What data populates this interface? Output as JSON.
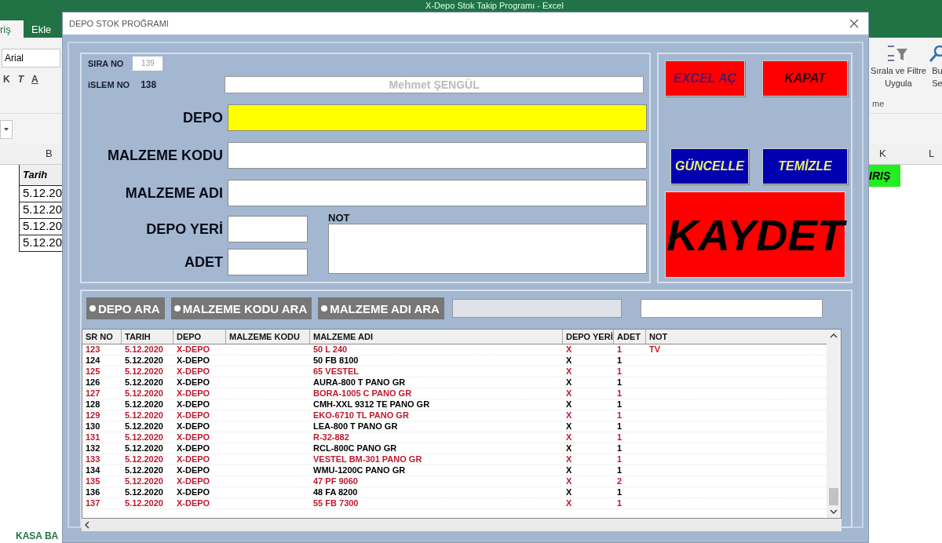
{
  "excel": {
    "title": "X-Depo Stok Takip Programı - Excel",
    "tabs": [
      {
        "label": "riş",
        "selected": true
      },
      {
        "label": "Ekle",
        "selected": false
      }
    ],
    "font_box": "Arial",
    "format_buttons": [
      "K",
      "T",
      "A"
    ],
    "sort_label": [
      "Sırala ve Filtre",
      "Uygula"
    ],
    "search_label": [
      "Bu",
      "Se"
    ],
    "group_label": "me",
    "col_b": "B",
    "col_k": "K",
    "col_l": "L",
    "header_cell": "Tarih",
    "dates": [
      "5.12.20",
      "5.12.20",
      "5.12.20",
      "5.12.20"
    ],
    "green_cell": "IRIŞ",
    "sheet_tab": "KASA BA"
  },
  "dialog": {
    "title": "DEPO STOK PROĞRAMI",
    "sira_no": {
      "label": "SIRA NO",
      "value": "139",
      "disabled": true
    },
    "islem_no": {
      "label": "iSLEM NO",
      "value": "138"
    },
    "user_field": {
      "value": "Mehmet  ŞENGÜL",
      "disabled": true
    },
    "fields": [
      {
        "label": "DEPO",
        "focused": true,
        "kind": "wide"
      },
      {
        "label": "MALZEME KODU",
        "focused": false,
        "kind": "wide"
      },
      {
        "label": "MALZEME ADI",
        "focused": false,
        "kind": "wide"
      },
      {
        "label": "DEPO YERİ",
        "focused": false,
        "kind": "short"
      },
      {
        "label": "ADET",
        "focused": false,
        "kind": "short"
      }
    ],
    "note": {
      "label": "NOT"
    },
    "buttons": [
      {
        "label": "EXCEL AÇ",
        "kind": "red"
      },
      {
        "label": "KAPAT",
        "kind": "red"
      },
      {
        "label": "GÜNCELLE",
        "kind": "blue"
      },
      {
        "label": "TEMİZLE",
        "kind": "blue"
      }
    ],
    "save_button": "KAYDET",
    "search_options": [
      {
        "label": "DEPO ARA",
        "selected": false
      },
      {
        "label": "MALZEME KODU ARA",
        "selected": false
      },
      {
        "label": "MALZEME ADI ARA",
        "selected": false
      }
    ],
    "search_field": {
      "disabled": true
    },
    "filter_field": {
      "disabled": false
    },
    "table": {
      "columns": [
        "SR NO",
        "TARIH",
        "DEPO",
        "MALZEME KODU",
        "MALZEME ADI",
        "DEPO YERİ",
        "ADET",
        "NOT"
      ],
      "rows": [
        {
          "color": "#c0182c",
          "cells": [
            "123",
            "5.12.2020",
            "X-DEPO",
            "",
            "50 L 240",
            "X",
            "1",
            "TV"
          ]
        },
        {
          "color": "#000000",
          "cells": [
            "124",
            "5.12.2020",
            "X-DEPO",
            "",
            "50 FB 8100",
            "X",
            "1",
            ""
          ]
        },
        {
          "color": "#c0182c",
          "cells": [
            "125",
            "5.12.2020",
            "X-DEPO",
            "",
            "65 VESTEL",
            "X",
            "1",
            ""
          ]
        },
        {
          "color": "#000000",
          "cells": [
            "126",
            "5.12.2020",
            "X-DEPO",
            "",
            "AURA-800 T PANO GR",
            "X",
            "1",
            ""
          ]
        },
        {
          "color": "#c0182c",
          "cells": [
            "127",
            "5.12.2020",
            "X-DEPO",
            "",
            "BORA-1005 C PANO GR",
            "X",
            "1",
            ""
          ]
        },
        {
          "color": "#000000",
          "cells": [
            "128",
            "5.12.2020",
            "X-DEPO",
            "",
            "CMH-XXL 9312 TE PANO GR",
            "X",
            "1",
            ""
          ]
        },
        {
          "color": "#c0182c",
          "cells": [
            "129",
            "5.12.2020",
            "X-DEPO",
            "",
            "EKO-6710 TL  PANO GR",
            "X",
            "1",
            ""
          ]
        },
        {
          "color": "#000000",
          "cells": [
            "130",
            "5.12.2020",
            "X-DEPO",
            "",
            "LEA-800 T PANO GR",
            "X",
            "1",
            ""
          ]
        },
        {
          "color": "#c0182c",
          "cells": [
            "131",
            "5.12.2020",
            "X-DEPO",
            "",
            "R-32-882",
            "X",
            "1",
            ""
          ]
        },
        {
          "color": "#000000",
          "cells": [
            "132",
            "5.12.2020",
            "X-DEPO",
            "",
            "RCL-800C PANO GR",
            "X",
            "1",
            ""
          ]
        },
        {
          "color": "#c0182c",
          "cells": [
            "133",
            "5.12.2020",
            "X-DEPO",
            "",
            "VESTEL BM-301 PANO GR",
            "X",
            "1",
            ""
          ]
        },
        {
          "color": "#000000",
          "cells": [
            "134",
            "5.12.2020",
            "X-DEPO",
            "",
            "WMU-1200C PANO GR",
            "X",
            "1",
            ""
          ]
        },
        {
          "color": "#c0182c",
          "cells": [
            "135",
            "5.12.2020",
            "X-DEPO",
            "",
            "47 PF 9060",
            "X",
            "2",
            ""
          ]
        },
        {
          "color": "#000000",
          "cells": [
            "136",
            "5.12.2020",
            "X-DEPO",
            "",
            "48 FA 8200",
            "X",
            "1",
            ""
          ]
        },
        {
          "color": "#c0182c",
          "cells": [
            "137",
            "5.12.2020",
            "X-DEPO",
            "",
            "55 FB 7300",
            "X",
            "1",
            ""
          ]
        }
      ]
    }
  }
}
